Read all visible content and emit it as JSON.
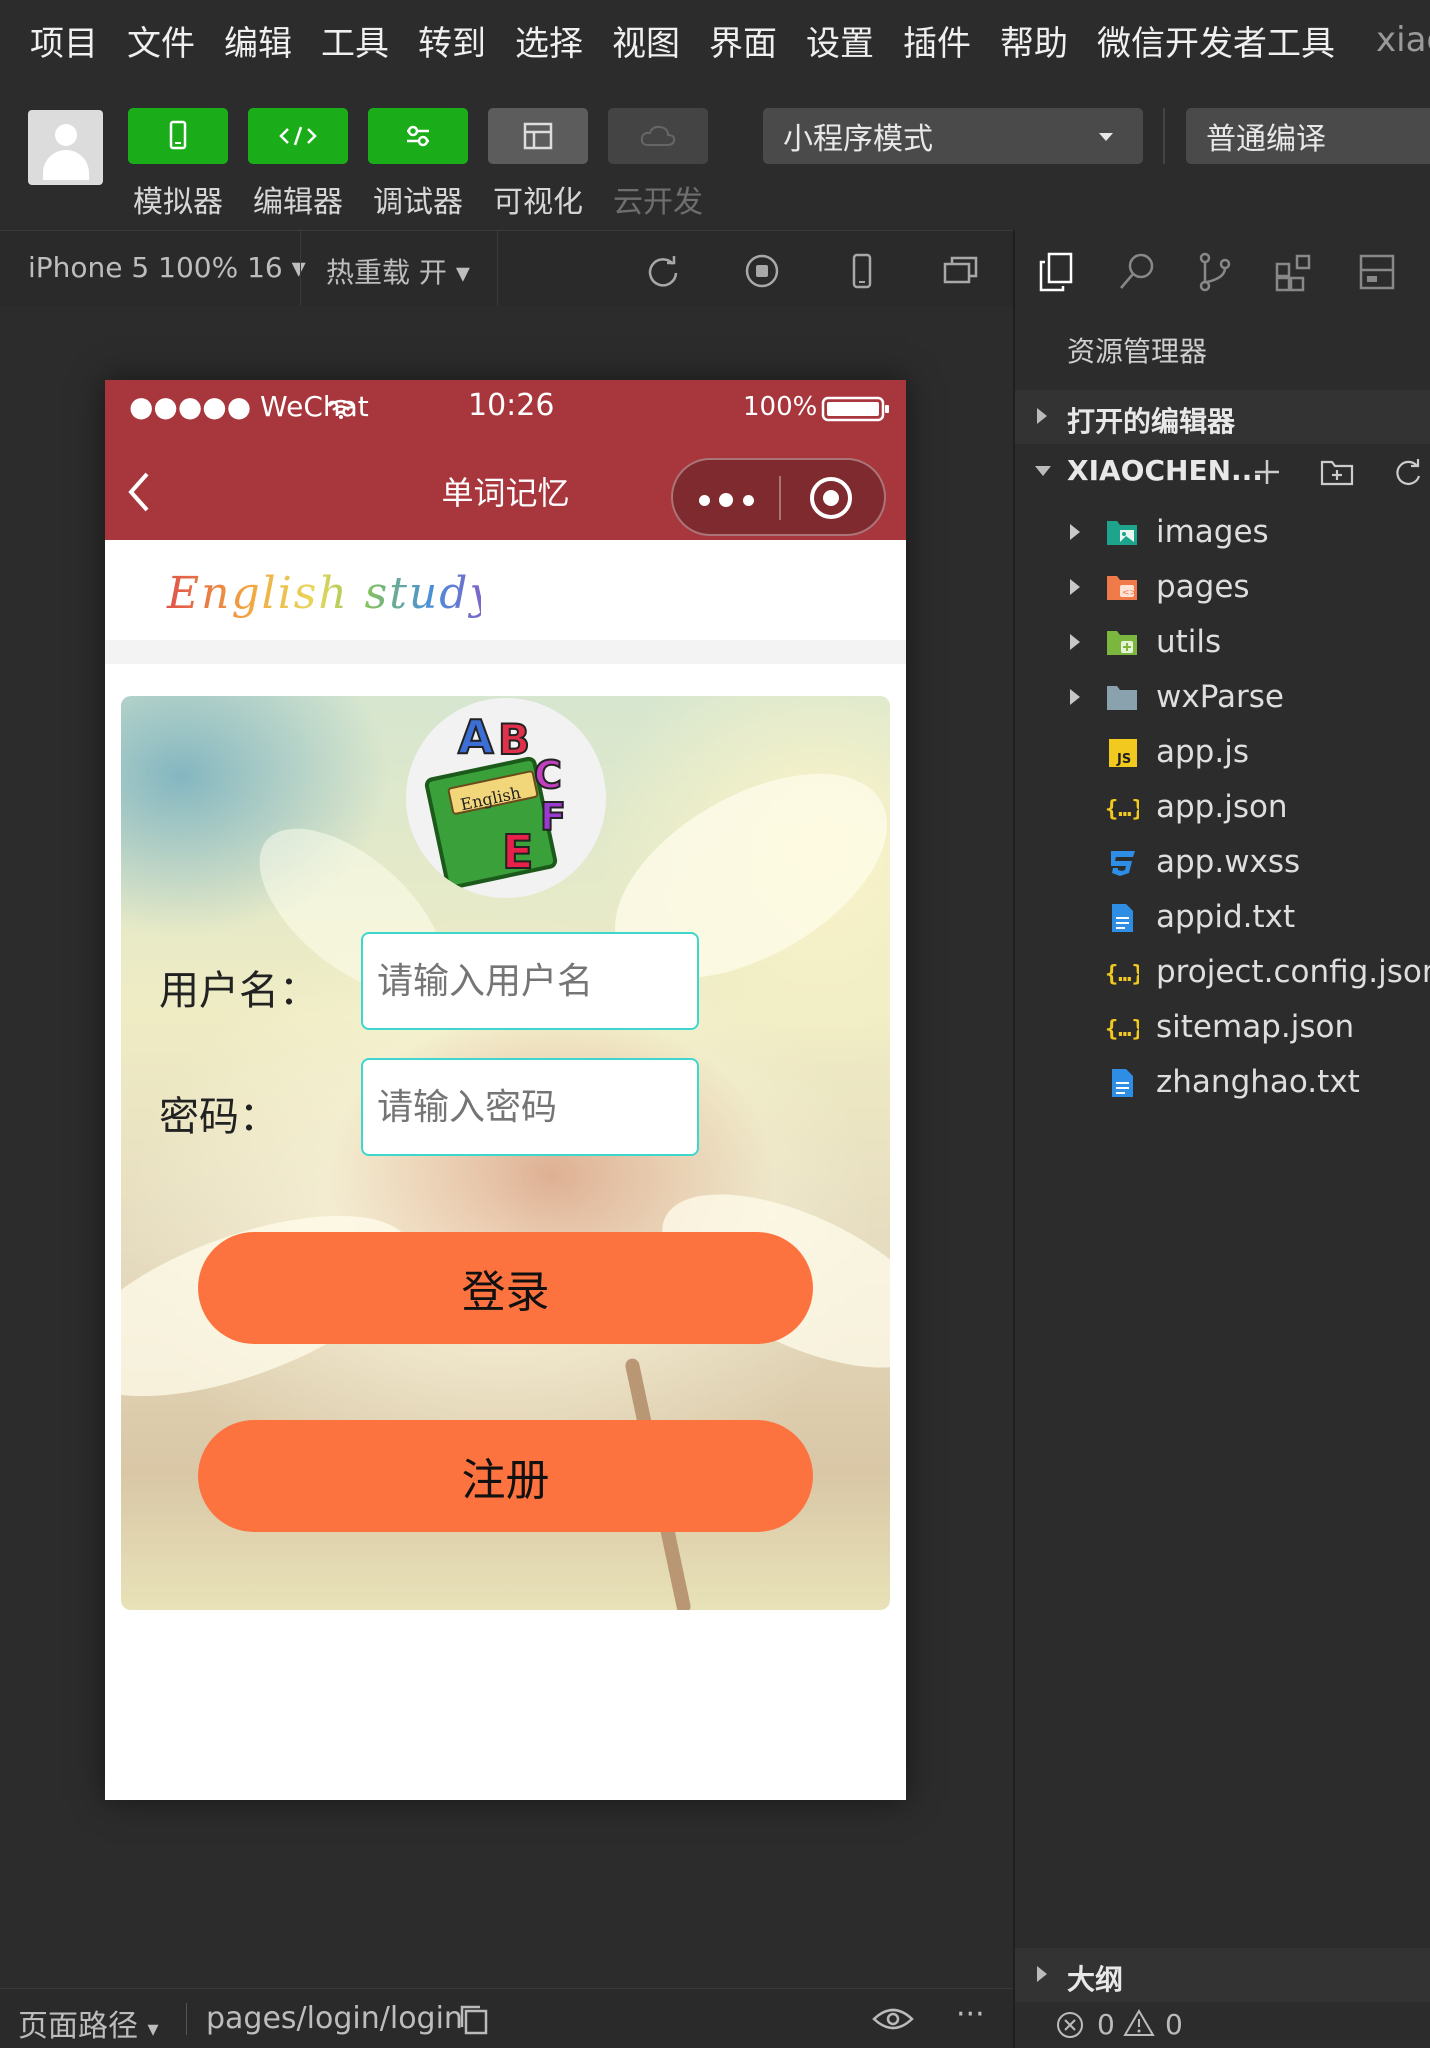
{
  "menu": [
    "项目",
    "文件",
    "编辑",
    "工具",
    "转到",
    "选择",
    "视图",
    "界面",
    "设置",
    "插件",
    "帮助",
    "微信开发者工具"
  ],
  "project_name": "xiaocheng",
  "toolbar": {
    "buttons": [
      {
        "label": "模拟器",
        "icon": "phone-icon"
      },
      {
        "label": "编辑器",
        "icon": "code-icon"
      },
      {
        "label": "调试器",
        "icon": "debug-icon"
      },
      {
        "label": "可视化",
        "icon": "layout-icon"
      },
      {
        "label": "云开发",
        "icon": "cloud-icon"
      }
    ],
    "mode_select": "小程序模式",
    "compile_select": "普通编译"
  },
  "simulator": {
    "device": "iPhone 5 100% 16",
    "hot_reload": "热重载 开"
  },
  "phone": {
    "status": {
      "carrier": "●●●●● WeChat",
      "time": "10:26",
      "battery": "100%"
    },
    "nav_title": "单词记忆",
    "logo_text": "English study",
    "badge_text": "English",
    "form": {
      "username_label": "用户名：",
      "username_placeholder": "请输入用户名",
      "password_label": "密码：",
      "password_placeholder": "请输入密码",
      "login_button": "登录",
      "register_button": "注册"
    }
  },
  "explorer": {
    "title": "资源管理器",
    "open_editors": "打开的编辑器",
    "project_folder": "XIAOCHEN...",
    "files": [
      {
        "name": "images",
        "type": "folder",
        "icon": "images-folder-icon",
        "color": "#1ea48c"
      },
      {
        "name": "pages",
        "type": "folder",
        "icon": "pages-folder-icon",
        "color": "#f07a4a"
      },
      {
        "name": "utils",
        "type": "folder",
        "icon": "utils-folder-icon",
        "color": "#7bb63f"
      },
      {
        "name": "wxParse",
        "type": "folder",
        "icon": "folder-icon",
        "color": "#8aa1ae"
      },
      {
        "name": "app.js",
        "type": "file",
        "icon": "js-file-icon",
        "color": "#f2c91e"
      },
      {
        "name": "app.json",
        "type": "file",
        "icon": "json-file-icon",
        "color": "#f2c91e"
      },
      {
        "name": "app.wxss",
        "type": "file",
        "icon": "css-file-icon",
        "color": "#2e8ee6"
      },
      {
        "name": "appid.txt",
        "type": "file",
        "icon": "text-file-icon",
        "color": "#2e8ee6"
      },
      {
        "name": "project.config.json",
        "type": "file",
        "icon": "json-file-icon",
        "color": "#f2c91e"
      },
      {
        "name": "sitemap.json",
        "type": "file",
        "icon": "json-file-icon",
        "color": "#f2c91e"
      },
      {
        "name": "zhanghao.txt",
        "type": "file",
        "icon": "text-file-icon",
        "color": "#2e8ee6"
      }
    ],
    "outline": "大纲",
    "errors": "0",
    "warnings": "0"
  },
  "footer": {
    "path_label": "页面路径",
    "path": "pages/login/login"
  }
}
